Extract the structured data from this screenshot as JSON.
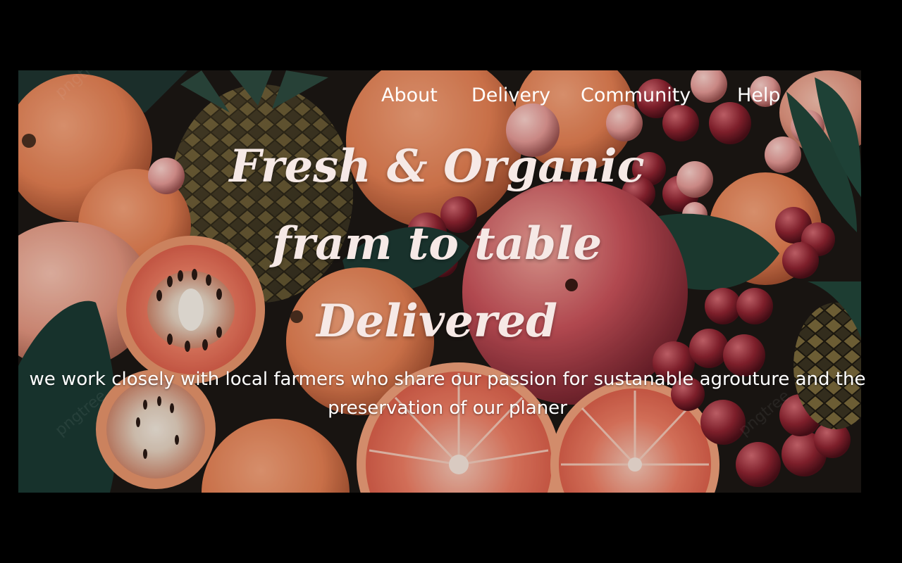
{
  "nav": {
    "items": [
      {
        "label": "About"
      },
      {
        "label": "Delivery"
      },
      {
        "label": "Community"
      },
      {
        "label": "Help"
      }
    ]
  },
  "hero": {
    "title_lines": [
      "Fresh & Organic",
      "fram to table",
      "Delivered"
    ],
    "subtitle": "we work closely with local farmers who share our passion for sustanable agrouture and the preservation of our planer",
    "watermark": "pngtree"
  },
  "colors": {
    "page_background": "#000000",
    "nav_text": "#ffffff",
    "title_text": "#f6e9e6",
    "subtitle_text": "#ffffff",
    "orange": "#e8875a",
    "grape": "#8a1f2c",
    "leaf": "#1f3b33",
    "grapefruit": "#e86a56"
  },
  "icons": {
    "hero_image": "fruit-assortment-image"
  }
}
